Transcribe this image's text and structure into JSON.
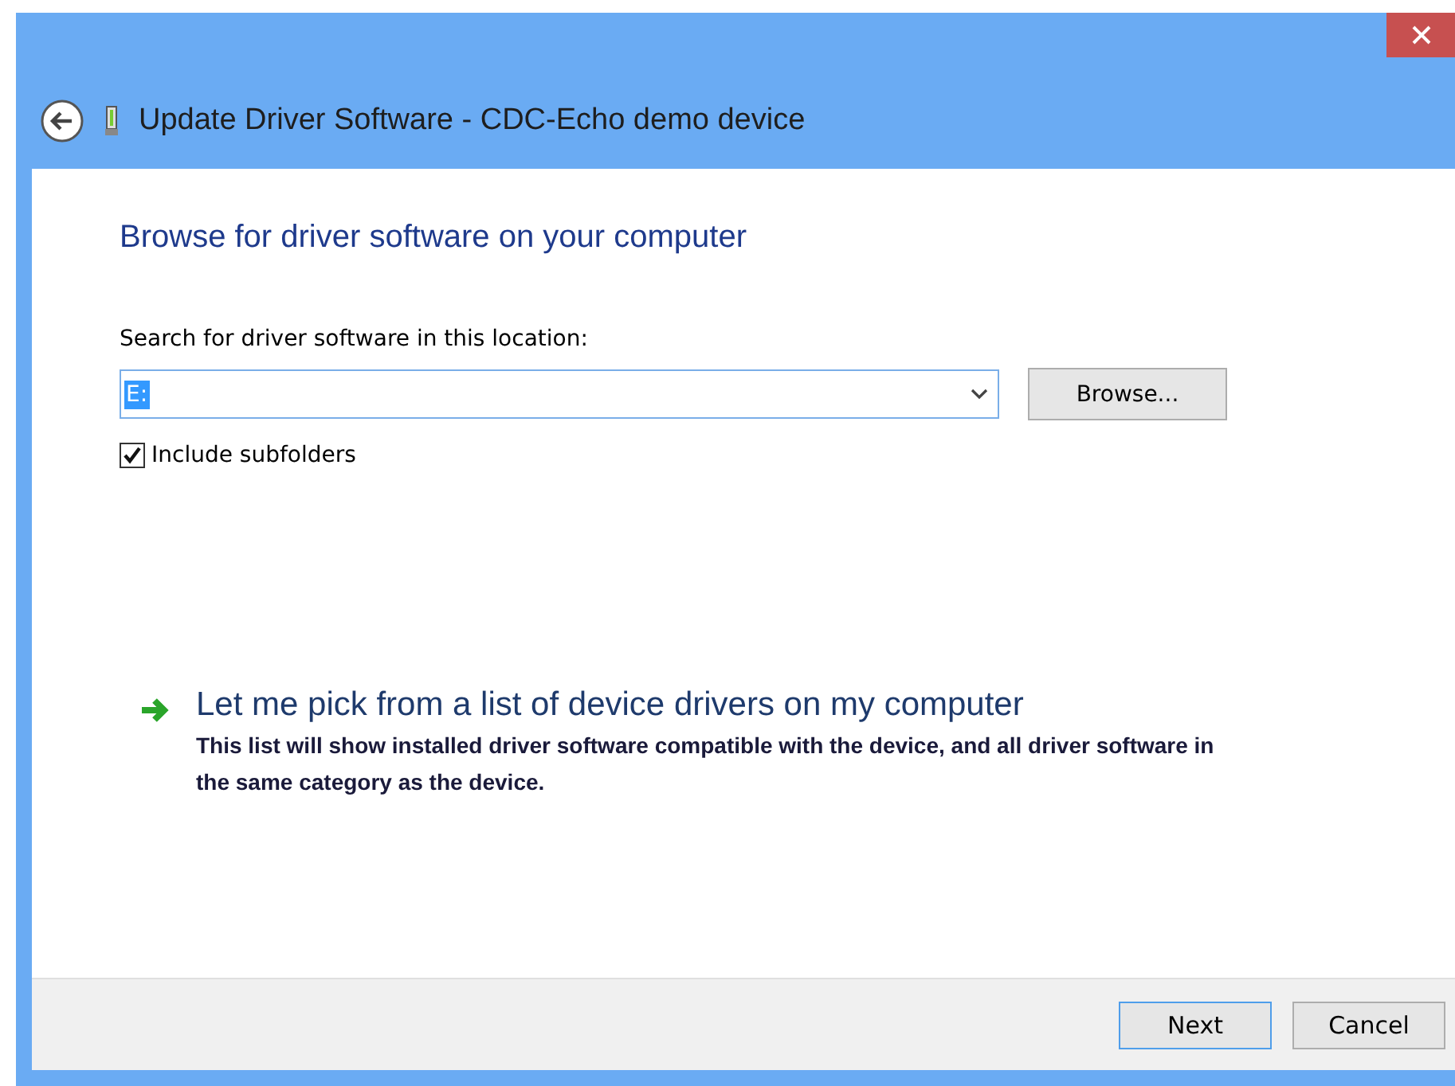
{
  "window": {
    "title": "Update Driver Software - CDC-Echo demo device"
  },
  "heading": "Browse for driver software on your computer",
  "location": {
    "label": "Search for driver software in this location:",
    "value": "E:",
    "value_selected": true
  },
  "browse_button": "Browse...",
  "include_subfolders": {
    "label": "Include subfolders",
    "checked": true
  },
  "pick_option": {
    "title": "Let me pick from a list of device drivers on my computer",
    "description": "This list will show installed driver software compatible with the device, and all driver software in the same category as the device."
  },
  "buttons": [
    {
      "label": "Next",
      "default": true
    },
    {
      "label": "Cancel",
      "default": false
    }
  ]
}
